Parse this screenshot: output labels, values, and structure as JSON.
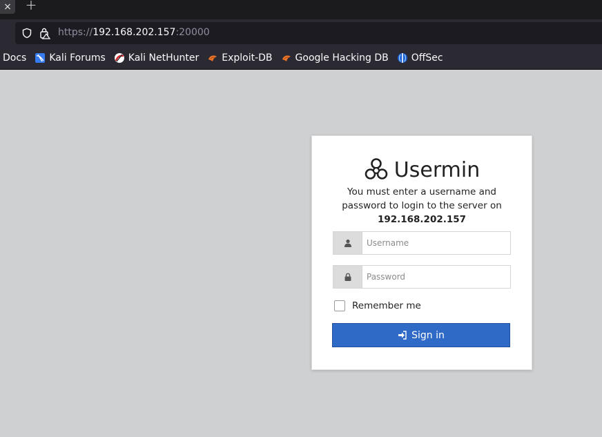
{
  "browser": {
    "tab_close_glyph": "×",
    "newtab_glyph": "+",
    "url": {
      "scheme": "https://",
      "host": "192.168.202.157",
      "port": ":20000"
    },
    "bookmarks": [
      {
        "label": "Docs",
        "icon": "none"
      },
      {
        "label": "Kali Forums",
        "icon": "kali-forums-icon"
      },
      {
        "label": "Kali NetHunter",
        "icon": "kali-nethunter-icon"
      },
      {
        "label": "Exploit-DB",
        "icon": "exploit-db-icon"
      },
      {
        "label": "Google Hacking DB",
        "icon": "google-hacking-db-icon"
      },
      {
        "label": "OffSec",
        "icon": "offsec-icon"
      }
    ]
  },
  "login": {
    "title": "Usermin",
    "message_line": "You must enter a username and password to login to the server on",
    "server": "192.168.202.157",
    "username_placeholder": "Username",
    "password_placeholder": "Password",
    "remember_label": "Remember me",
    "signin_label": "Sign in"
  },
  "colors": {
    "page_bg": "#cfd0d1",
    "signin_bg": "#2f6ac7",
    "chrome_bg": "#2b2a33"
  }
}
